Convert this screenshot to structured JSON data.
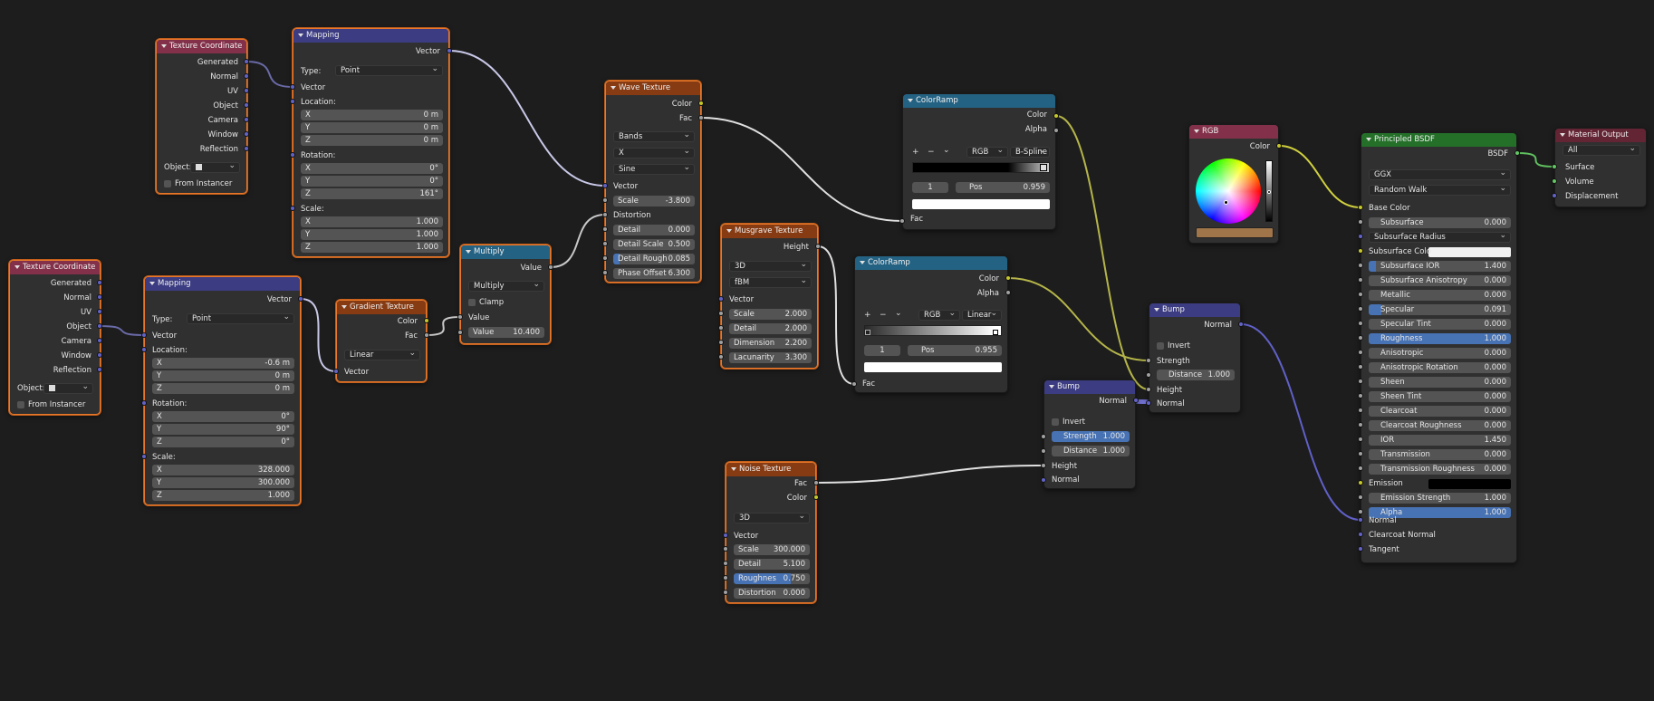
{
  "wheel_swatch": "#a0754a",
  "nodes": {
    "tc1": {
      "title": "Texture Coordinate",
      "generated": "Generated",
      "normal": "Normal",
      "uv": "UV",
      "object": "Object",
      "camera": "Camera",
      "window": "Window",
      "reflection": "Reflection",
      "object_label": "Object:",
      "from_instancer": "From Instancer"
    },
    "tc2": {
      "title": "Texture Coordinate",
      "generated": "Generated",
      "normal": "Normal",
      "uv": "UV",
      "object": "Object",
      "camera": "Camera",
      "window": "Window",
      "reflection": "Reflection",
      "object_label": "Object:",
      "from_instancer": "From Instancer"
    },
    "map1": {
      "title": "Mapping",
      "vector_out": "Vector",
      "type_label": "Type:",
      "type": "Point",
      "vector_in": "Vector",
      "location": "Location:",
      "rotation": "Rotation:",
      "scale": "Scale:",
      "x": "X",
      "y": "Y",
      "z": "Z",
      "loc": [
        "0 m",
        "0 m",
        "0 m"
      ],
      "rot": [
        "0°",
        "0°",
        "161°"
      ],
      "scl": [
        "1.000",
        "1.000",
        "1.000"
      ]
    },
    "map2": {
      "title": "Mapping",
      "vector_out": "Vector",
      "type_label": "Type:",
      "type": "Point",
      "vector_in": "Vector",
      "location": "Location:",
      "rotation": "Rotation:",
      "scale": "Scale:",
      "x": "X",
      "y": "Y",
      "z": "Z",
      "loc": [
        "-0.6 m",
        "0 m",
        "0 m"
      ],
      "rot": [
        "0°",
        "90°",
        "0°"
      ],
      "scl": [
        "328.000",
        "300.000",
        "1.000"
      ]
    },
    "grad": {
      "title": "Gradient Texture",
      "color": "Color",
      "fac": "Fac",
      "type": "Linear",
      "vector": "Vector"
    },
    "mult": {
      "title": "Multiply",
      "value_out": "Value",
      "op": "Multiply",
      "clamp": "Clamp",
      "value_in": "Value",
      "value_label": "Value",
      "value": "10.400"
    },
    "wave": {
      "title": "Wave Texture",
      "color": "Color",
      "fac": "Fac",
      "type": "Bands",
      "dir": "X",
      "profile": "Sine",
      "vector": "Vector",
      "scale_l": "Scale",
      "scale": "-3.800",
      "distortion": "Distortion",
      "detail_l": "Detail",
      "detail": "0.000",
      "dscale_l": "Detail Scale",
      "dscale": "0.500",
      "drough_l": "Detail Rough",
      "drough": "0.085",
      "phase_l": "Phase Offset",
      "phase": "6.300"
    },
    "musg": {
      "title": "Musgrave Texture",
      "height": "Height",
      "dim": "3D",
      "type": "fBM",
      "vector": "Vector",
      "scale_l": "Scale",
      "scale": "2.000",
      "detail_l": "Detail",
      "detail": "2.000",
      "dimension_l": "Dimension",
      "dimension": "2.200",
      "lac_l": "Lacunarity",
      "lac": "3.300"
    },
    "noise": {
      "title": "Noise Texture",
      "fac": "Fac",
      "color": "Color",
      "dim": "3D",
      "vector": "Vector",
      "scale_l": "Scale",
      "scale": "300.000",
      "detail_l": "Detail",
      "detail": "5.100",
      "rough_l": "Roughnes",
      "rough": "0.750",
      "dist_l": "Distortion",
      "dist": "0.000"
    },
    "ramp1": {
      "title": "ColorRamp",
      "color": "Color",
      "alpha": "Alpha",
      "plus": "+",
      "minus": "−",
      "chev": "⌄",
      "mode": "RGB",
      "interp": "B-Spline",
      "index": "1",
      "pos_l": "Pos",
      "pos": "0.959",
      "fac": "Fac"
    },
    "ramp2": {
      "title": "ColorRamp",
      "color": "Color",
      "alpha": "Alpha",
      "plus": "+",
      "minus": "−",
      "chev": "⌄",
      "mode": "RGB",
      "interp": "Linear",
      "index": "1",
      "pos_l": "Pos",
      "pos": "0.955",
      "fac": "Fac"
    },
    "bump1": {
      "title": "Bump",
      "normal_out": "Normal",
      "invert": "Invert",
      "strength_l": "Strength",
      "strength": "1.000",
      "dist_l": "Distance",
      "dist": "1.000",
      "height": "Height",
      "normal_in": "Normal"
    },
    "bump2": {
      "title": "Bump",
      "normal_out": "Normal",
      "invert": "Invert",
      "strength": "Strength",
      "dist_l": "Distance",
      "dist": "1.000",
      "height": "Height",
      "normal_in": "Normal"
    },
    "rgb": {
      "title": "RGB",
      "color": "Color"
    },
    "bsdf": {
      "title": "Principled BSDF",
      "bsdf": "BSDF",
      "dist": "GGX",
      "sss_method": "Random Walk",
      "base_color": "Base Color",
      "props": [
        {
          "l": "Subsurface",
          "v": "0.000",
          "f": 0
        },
        {
          "l": "Subsurface Radius",
          "v": "",
          "f": 0,
          "dd": true
        },
        {
          "l": "Subsurface Colo",
          "v": "",
          "f": 0,
          "white": true
        },
        {
          "l": "Subsurface IOR",
          "v": "1.400",
          "f": 0.05
        },
        {
          "l": "Subsurface Anisotropy",
          "v": "0.000",
          "f": 0
        },
        {
          "l": "Metallic",
          "v": "0.000",
          "f": 0
        },
        {
          "l": "Specular",
          "v": "0.091",
          "f": 0.09
        },
        {
          "l": "Specular Tint",
          "v": "0.000",
          "f": 0
        },
        {
          "l": "Roughness",
          "v": "1.000",
          "f": 1
        },
        {
          "l": "Anisotropic",
          "v": "0.000",
          "f": 0
        },
        {
          "l": "Anisotropic Rotation",
          "v": "0.000",
          "f": 0
        },
        {
          "l": "Sheen",
          "v": "0.000",
          "f": 0
        },
        {
          "l": "Sheen Tint",
          "v": "0.000",
          "f": 0
        },
        {
          "l": "Clearcoat",
          "v": "0.000",
          "f": 0
        },
        {
          "l": "Clearcoat Roughness",
          "v": "0.000",
          "f": 0
        },
        {
          "l": "IOR",
          "v": "1.450",
          "f": 0
        },
        {
          "l": "Transmission",
          "v": "0.000",
          "f": 0
        },
        {
          "l": "Transmission Roughness",
          "v": "0.000",
          "f": 0
        },
        {
          "l": "Emission",
          "v": "",
          "f": 0,
          "black": true
        },
        {
          "l": "Emission Strength",
          "v": "1.000",
          "f": 0
        },
        {
          "l": "Alpha",
          "v": "1.000",
          "f": 1
        }
      ],
      "normal": "Normal",
      "cc_normal": "Clearcoat Normal",
      "tangent": "Tangent"
    },
    "out": {
      "title": "Material Output",
      "target": "All",
      "surface": "Surface",
      "volume": "Volume",
      "displacement": "Displacement"
    }
  }
}
